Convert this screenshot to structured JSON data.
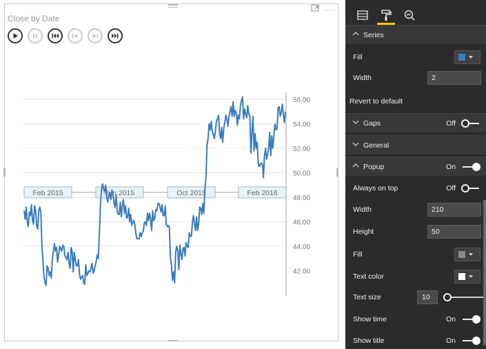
{
  "visual": {
    "title": "Close by Date",
    "header_icons": [
      "focus-mode-icon",
      "more-options-icon"
    ],
    "more_label": "···"
  },
  "player": {
    "controls": [
      {
        "name": "play-button",
        "icon": "play-icon",
        "enabled": true
      },
      {
        "name": "pause-button",
        "icon": "pause-icon",
        "enabled": false
      },
      {
        "name": "skip-back-button",
        "icon": "skip-back-icon",
        "enabled": true
      },
      {
        "name": "step-back-button",
        "icon": "step-back-icon",
        "enabled": false
      },
      {
        "name": "step-forward-button",
        "icon": "step-forward-icon",
        "enabled": false
      },
      {
        "name": "skip-forward-button",
        "icon": "skip-forward-icon",
        "enabled": true
      }
    ]
  },
  "chart_data": {
    "type": "line",
    "title": "",
    "xlabel": "",
    "ylabel": "",
    "ylim": [
      40.5,
      57
    ],
    "y_ticks": [
      "56.00",
      "54.00",
      "52.00",
      "50.00",
      "48.00",
      "46.00",
      "44.00",
      "42.00"
    ],
    "y_tick_values": [
      56,
      54,
      52,
      50,
      48,
      46,
      44,
      42
    ],
    "y_axis_position": "right",
    "grid": true,
    "time_markers": [
      "Feb 2015",
      "Jun 2015",
      "Oct 2015",
      "Feb 2016"
    ],
    "series_color": "#3a7bbf",
    "series": [
      {
        "values": [
          46.9,
          46.2,
          47.2,
          46.0,
          45.6,
          46.8,
          46.5,
          47.4,
          46.1,
          45.8,
          47.3,
          46.9,
          45.7,
          45.4,
          46.9,
          47.2,
          46.8,
          44.1,
          42.8,
          41.5,
          41.0,
          40.8,
          42.4,
          42.2,
          41.6,
          41.9,
          41.4,
          42.9,
          43.6,
          44.2,
          43.6,
          43.9,
          42.7,
          43.3,
          44.0,
          43.8,
          43.6,
          44.1,
          44.0,
          43.2,
          43.1,
          42.9,
          43.5,
          42.6,
          42.2,
          43.9,
          43.5,
          41.9,
          43.5,
          42.9,
          42.4,
          42.4,
          42.9,
          41.7,
          41.3,
          41.5,
          41.6,
          41.0,
          40.9,
          42.5,
          41.6,
          41.8,
          42.0,
          41.9,
          42.2,
          42.6,
          41.8,
          42.0,
          42.4,
          42.8,
          43.3,
          43.0,
          45.0,
          47.3,
          48.6,
          49.1,
          48.7,
          48.4,
          49.0,
          48.1,
          47.6,
          48.1,
          48.4,
          47.8,
          48.6,
          48.3,
          47.5,
          47.2,
          48.2,
          46.9,
          46.6,
          46.6,
          47.6,
          46.4,
          47.3,
          47.8,
          46.7,
          47.3,
          46.3,
          46.4,
          47.1,
          46.0,
          46.6,
          45.7,
          46.0,
          46.1,
          45.7,
          45.0,
          44.6,
          44.6,
          44.6,
          45.1,
          44.8,
          45.1,
          45.2,
          45.9,
          46.0,
          45.7,
          46.7,
          46.1,
          46.7,
          46.2,
          45.3,
          46.9,
          46.1,
          46.3,
          47.0,
          46.9,
          47.5,
          47.5,
          47.2,
          46.8,
          47.4,
          46.5,
          46.5,
          47.3,
          45.8,
          45.6,
          45.7,
          45.5,
          43.1,
          42.4,
          41.2,
          41.9,
          41.0,
          43.5,
          44.0,
          43.6,
          42.1,
          44.1,
          43.4,
          42.9,
          43.8,
          43.9,
          43.2,
          44.3,
          44.0,
          43.9,
          45.1,
          44.8,
          44.8,
          45.9,
          46.5,
          45.8,
          45.3,
          46.4,
          45.3,
          45.8,
          47.2,
          47.1,
          46.6,
          47.5,
          46.7,
          48.7,
          49.6,
          52.2,
          52.8,
          54.0,
          53.5,
          54.2,
          53.4,
          53.1,
          52.8,
          53.4,
          54.2,
          54.4,
          54.7,
          53.2,
          52.8,
          53.7,
          52.5,
          53.6,
          54.1,
          54.7,
          54.4,
          53.8,
          54.6,
          55.0,
          55.4,
          54.6,
          55.8,
          54.6,
          55.1,
          54.9,
          53.9,
          54.7,
          54.4,
          55.5,
          55.9,
          56.2,
          54.4,
          55.2,
          54.8,
          54.5,
          55.5,
          54.8,
          54.6,
          51.6,
          53.3,
          54.6,
          51.8,
          53.2,
          52.0,
          52.5,
          50.8,
          50.5,
          50.7,
          50.8,
          50.7,
          49.6,
          51.4,
          52.0,
          51.1,
          51.5,
          52.0,
          53.3,
          51.4,
          53.0,
          52.0,
          53.1,
          54.0,
          53.5,
          53.6,
          55.3,
          55.4,
          54.6,
          54.9,
          55.6,
          54.8,
          54.1,
          55.0
        ]
      }
    ]
  },
  "pane": {
    "tabs": [
      {
        "name": "tab-fields",
        "icon": "fields-icon",
        "active": false
      },
      {
        "name": "tab-format",
        "icon": "paint-roller-icon",
        "active": true
      },
      {
        "name": "tab-analytics",
        "icon": "analytics-icon",
        "active": false
      }
    ],
    "series": {
      "header": "Series",
      "fill_label": "Fill",
      "fill_color": "#3a7bbf",
      "width_label": "Width",
      "width_value": "2",
      "revert_label": "Revert to default"
    },
    "gaps": {
      "header": "Gaps",
      "state": "Off"
    },
    "general": {
      "header": "General"
    },
    "popup": {
      "header": "Popup",
      "state": "On",
      "always_on_top_label": "Always on top",
      "always_on_top_state": "Off",
      "width_label": "Width",
      "width_value": "210",
      "height_label": "Height",
      "height_value": "50",
      "fill_label": "Fill",
      "fill_color": "#8a8a8a",
      "text_color_label": "Text color",
      "text_color": "#ffffff",
      "text_size_label": "Text size",
      "text_size_value": "10",
      "show_time_label": "Show time",
      "show_time_state": "On",
      "show_title_label": "Show title",
      "show_title_state": "On"
    }
  }
}
